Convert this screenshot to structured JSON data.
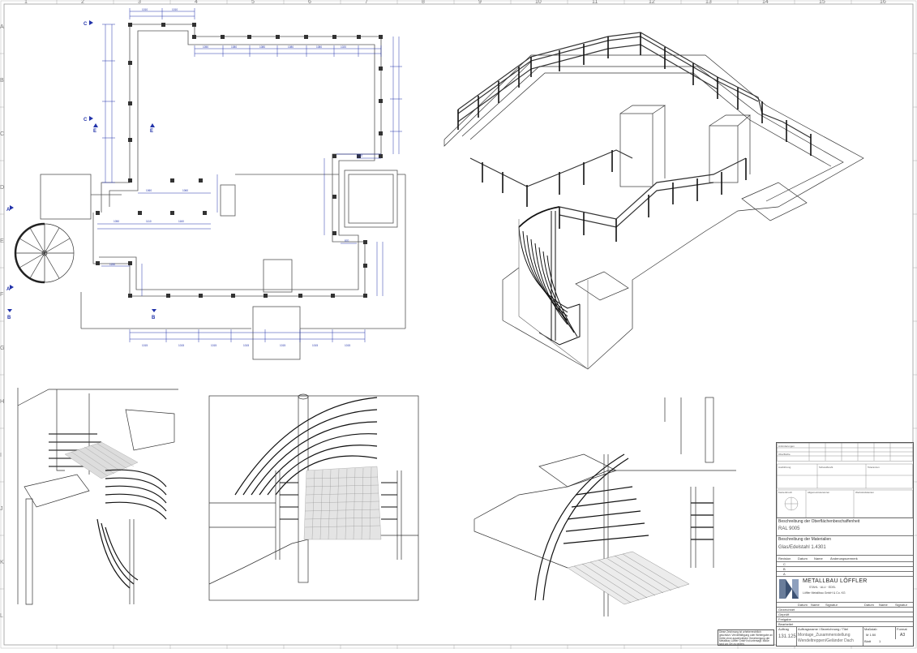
{
  "sheet": {
    "grid_columns": [
      "1",
      "2",
      "3",
      "4",
      "5",
      "6",
      "7",
      "8",
      "9",
      "10",
      "11",
      "12",
      "13",
      "14",
      "15",
      "16"
    ],
    "grid_rows": [
      "A",
      "B",
      "C",
      "D",
      "E",
      "F",
      "G",
      "H",
      "I",
      "J",
      "K",
      "L"
    ]
  },
  "plan": {
    "section_marks": [
      "A",
      "A",
      "B",
      "B",
      "C",
      "C",
      "E",
      "E"
    ],
    "dim_values": [
      "1010",
      "1320",
      "1050",
      "1110",
      "1160",
      "1080",
      "1020",
      "1015",
      "1250"
    ]
  },
  "title_block": {
    "surface_label": "Beschreibung der Oberflächenbeschaffenheit",
    "surface_value": "RAL 9005",
    "material_label": "Beschreibung der Materialien",
    "material_value": "Glas/Edelstahl 1.4301",
    "revision_headers": [
      "Revision",
      "Datum",
      "Name",
      "Änderungsvermerk"
    ],
    "revisions": [
      "C",
      "B",
      "A"
    ],
    "company_name": "METALLBAU LÖFFLER",
    "company_sub": "STAHL · ALU · EDEL",
    "company_address": "Löffler Metallbau GmbH & Co. KG",
    "row_headers": [
      "Datum",
      "Name",
      "Signatur",
      "Datum",
      "Name",
      "Signatur"
    ],
    "row_labels": [
      "Gezeichnet",
      "Geprüft",
      "Freigabe",
      "Bearbeitet"
    ],
    "project_label": "Auftrag",
    "drawing_title_label": "Auftragsname / Bezeichnung / Titel",
    "drawing_title": "Montage_Zusammenstellung",
    "drawing_subtitle": "Wendeltreppen/Geländer Dach",
    "project_no": "131.125",
    "format_label": "Format",
    "format_value": "A3",
    "scale_label": "Maßstab",
    "scale_value": "M 1:50",
    "sheet_label": "Blatt",
    "sheet_value": "1"
  },
  "notes": {
    "copyright": "Diese Zeichnung ist urheberrechtlich geschützt. Vervielfältigung oder Weitergabe an Dritte ohne ausdrückliche Genehmigung der Metallbau Löffler GmbH ist untersagt. Maße sind vor Ort zu prüfen."
  }
}
